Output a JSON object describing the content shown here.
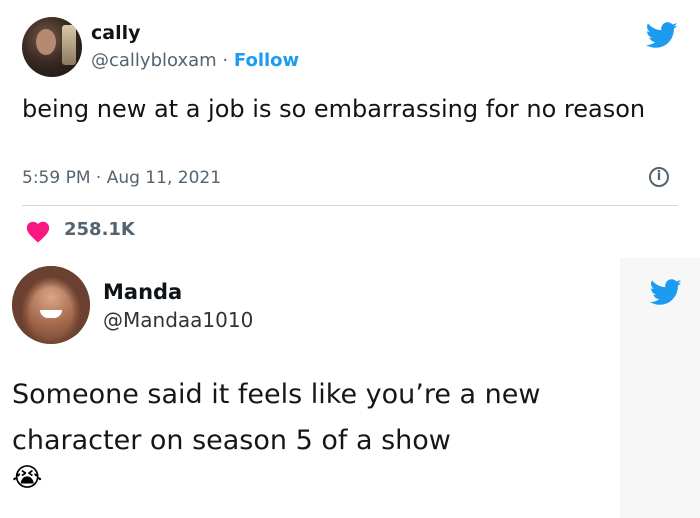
{
  "tweet1": {
    "display_name": "cally",
    "handle": "@callybloxam",
    "separator": "·",
    "follow_label": "Follow",
    "text": "being new at a job is so embarrassing for no reason",
    "timestamp": "5:59 PM · Aug 11, 2021",
    "info_glyph": "i",
    "like_count": "258.1K",
    "heart_color": "#f91880"
  },
  "tweet2": {
    "display_name": "Manda",
    "handle": "@Mandaa1010",
    "text": "Someone said it feels like you’re a new character on season 5 of a show",
    "emoji": "😭"
  },
  "colors": {
    "twitter_blue": "#1d9bf0",
    "secondary_text": "#536471"
  },
  "icons": [
    "twitter-bird-icon",
    "info-icon",
    "heart-icon"
  ]
}
